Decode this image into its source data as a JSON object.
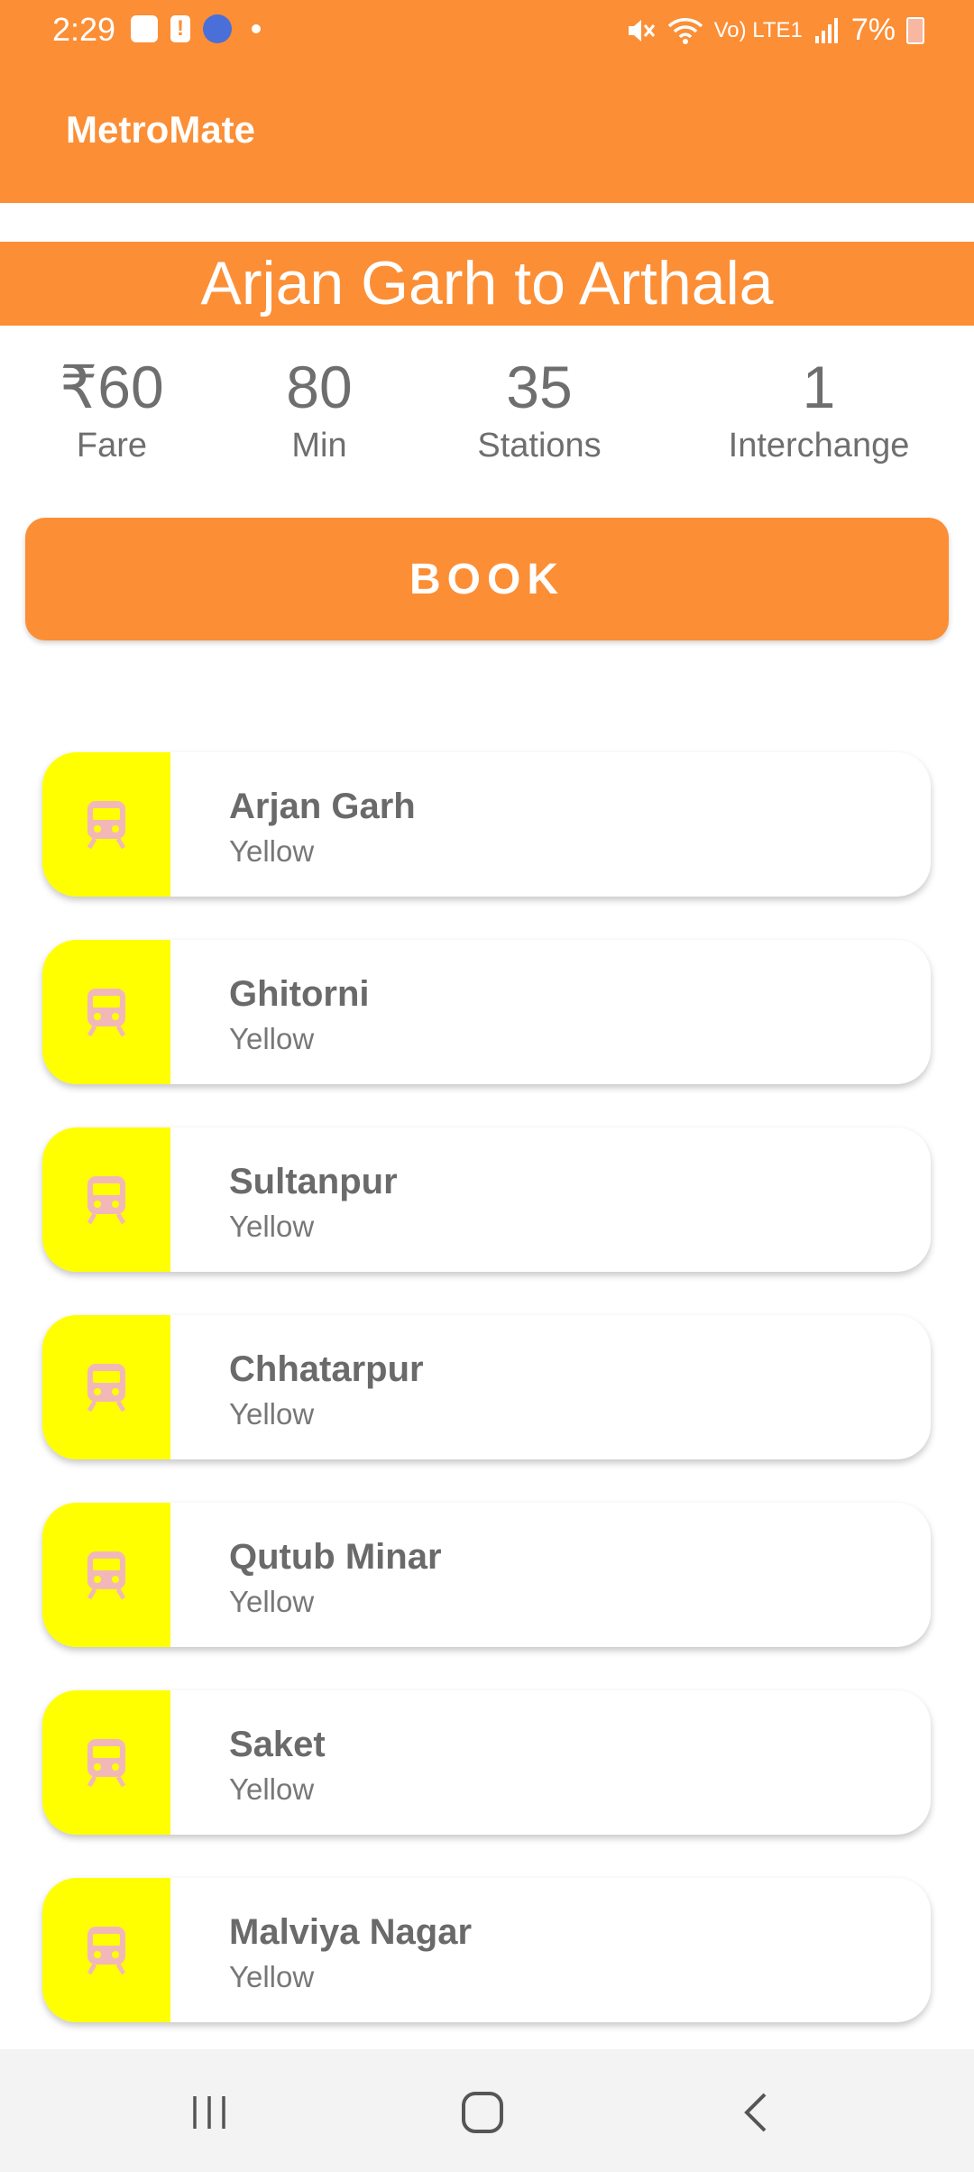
{
  "status_bar": {
    "time": "2:29",
    "battery": "7%",
    "signal_label": "Vo) LTE1"
  },
  "app": {
    "title": "MetroMate"
  },
  "route": {
    "title": "Arjan Garh to Arthala"
  },
  "stats": [
    {
      "value": "₹60",
      "label": "Fare"
    },
    {
      "value": "80",
      "label": "Min"
    },
    {
      "value": "35",
      "label": "Stations"
    },
    {
      "value": "1",
      "label": "Interchange"
    }
  ],
  "book_button": {
    "label": "BOOK"
  },
  "stations": [
    {
      "name": "Arjan Garh",
      "line": "Yellow",
      "color": "#FFFF00"
    },
    {
      "name": "Ghitorni",
      "line": "Yellow",
      "color": "#FFFF00"
    },
    {
      "name": "Sultanpur",
      "line": "Yellow",
      "color": "#FFFF00"
    },
    {
      "name": "Chhatarpur",
      "line": "Yellow",
      "color": "#FFFF00"
    },
    {
      "name": "Qutub Minar",
      "line": "Yellow",
      "color": "#FFFF00"
    },
    {
      "name": "Saket",
      "line": "Yellow",
      "color": "#FFFF00"
    },
    {
      "name": "Malviya Nagar",
      "line": "Yellow",
      "color": "#FFFF00"
    }
  ],
  "colors": {
    "accent": "#FC8E35",
    "line_yellow": "#FFFF00",
    "train_icon": "#F2B8B8"
  },
  "icons": {
    "station": "train-icon",
    "nav": [
      "recent-apps-icon",
      "home-icon",
      "back-icon"
    ]
  }
}
